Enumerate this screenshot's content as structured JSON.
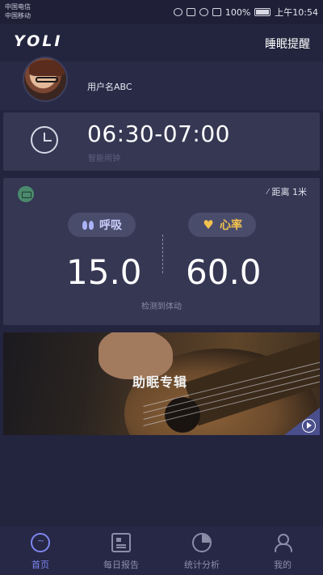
{
  "status_bar": {
    "carrier_1": "中国电信",
    "carrier_2": "中国移动",
    "battery": "100%",
    "time": "上午10:54"
  },
  "header": {
    "logo": "YOLI",
    "right_action": "睡眠提醒"
  },
  "profile": {
    "username": "用户名ABC"
  },
  "alarm": {
    "time_range": "06:30-07:00",
    "label": "智能闹钟"
  },
  "vitals": {
    "distance": "距离 1米",
    "breath_label": "呼吸",
    "breath_value": "15.0",
    "heart_label": "心率",
    "heart_value": "60.0",
    "status": "检测到体动"
  },
  "album": {
    "title": "助眠专辑"
  },
  "tabbar": {
    "tabs": [
      {
        "label": "首页",
        "active": true
      },
      {
        "label": "每日报告",
        "active": false
      },
      {
        "label": "统计分析",
        "active": false
      },
      {
        "label": "我的",
        "active": false
      }
    ]
  },
  "colors": {
    "background": "#23243e",
    "card": "#353753",
    "accent": "#7f86f0",
    "heart": "#f2c24e"
  }
}
